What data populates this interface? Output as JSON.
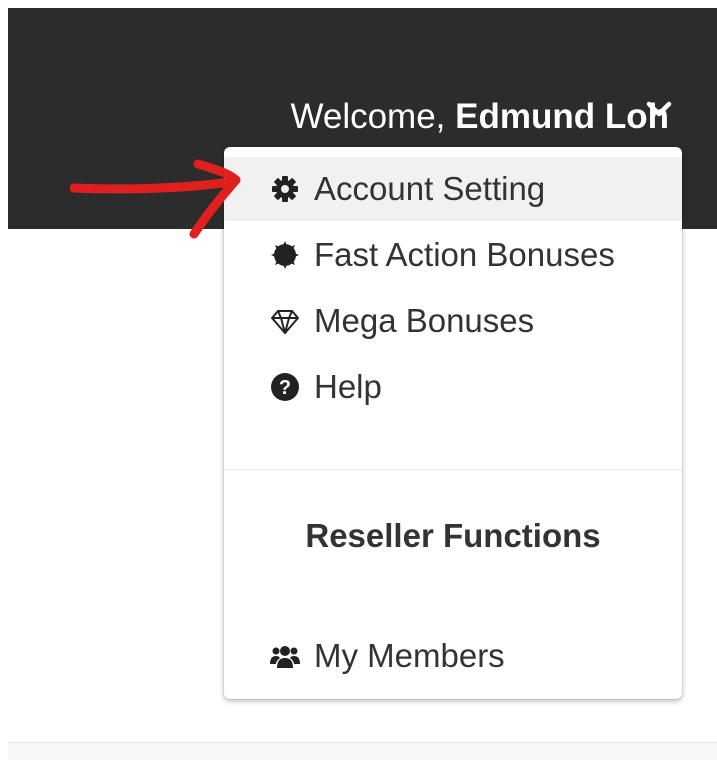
{
  "header": {
    "welcome_prefix": "Welcome, ",
    "user_name": "Edmund Loh"
  },
  "menu": {
    "items": [
      {
        "label": "Account Setting",
        "icon": "gear-icon"
      },
      {
        "label": "Fast Action Bonuses",
        "icon": "badge-icon"
      },
      {
        "label": "Mega Bonuses",
        "icon": "diamond-icon"
      },
      {
        "label": "Help",
        "icon": "question-circle-icon"
      }
    ],
    "section_title": "Reseller Functions",
    "section_items": [
      {
        "label": "My Members",
        "icon": "users-icon"
      }
    ]
  },
  "colors": {
    "topbar": "#2c2c2c",
    "annotation_arrow": "#e0201e",
    "highlight": "#f1f1f1"
  }
}
